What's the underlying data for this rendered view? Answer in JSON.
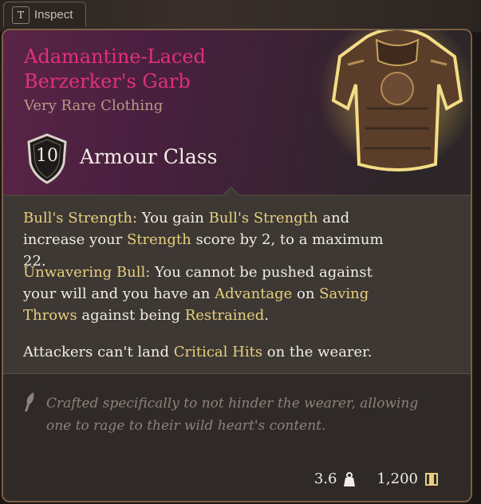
{
  "tab": {
    "key": "T",
    "label": "Inspect"
  },
  "item": {
    "name_line1": "Adamantine-Laced",
    "name_line2": "Berzerker's Garb",
    "rarity": "Very Rare Clothing",
    "armour_class_value": "10",
    "armour_class_label": "Armour Class"
  },
  "properties": [
    {
      "name": "Bull's Strength:",
      "text_a": " You gain ",
      "link_a": "Bull's Strength",
      "text_b": " and increase your ",
      "link_b": "Strength",
      "text_c": " score by 2, to a maximum 22."
    },
    {
      "name": "Unwavering Bull:",
      "text_a": " You cannot be pushed against your will and you have an ",
      "link_a": "Advantage",
      "text_b": " on ",
      "link_b": "Saving Throws",
      "text_c": " against being ",
      "link_c": "Restrained",
      "text_d": "."
    },
    {
      "text_a": "Attackers can't land ",
      "link_a": "Critical Hits",
      "text_b": " on the wearer."
    }
  ],
  "lore": "Crafted specifically to not hinder the wearer, allowing one to rage to their wild heart's content.",
  "footer": {
    "weight": "3.6",
    "value": "1,200"
  },
  "icons": {
    "weight": "weight-icon",
    "gold": "gold-coin-icon",
    "shield": "shield-icon",
    "quill": "quill-icon"
  },
  "colors": {
    "rarity_pink": "#e0317a",
    "keyword_gold": "#e7cf7d",
    "frame_bronze": "#7a5f45"
  }
}
